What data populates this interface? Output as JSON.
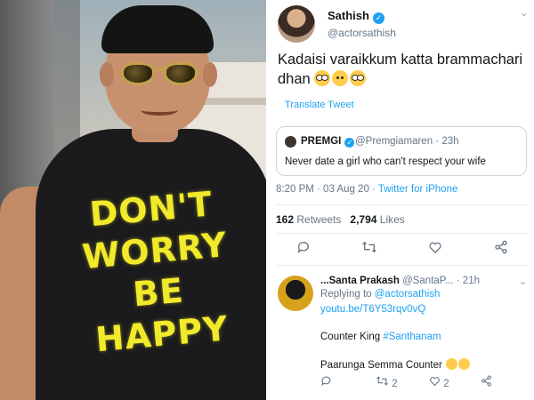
{
  "tweet": {
    "author_name": "Sathish",
    "author_handle": "@actorsathish",
    "text": "Kadaisi varaikkum katta brammachari dhan",
    "translate_label": "Translate Tweet",
    "quoted": {
      "author_name": "PREMGI",
      "author_handle": "@Premgiamaren",
      "time": "23h",
      "text": "Never date a girl who can't respect your wife"
    },
    "timestamp": "8:20 PM · 03 Aug 20",
    "via": "Twitter for iPhone",
    "retweets": "162",
    "retweets_label": "Retweets",
    "likes": "2,794",
    "likes_label": "Likes"
  },
  "photo": {
    "shirt_text": "DON'T WORRY BE HAPPY"
  },
  "reply": {
    "author_name": "...Santa Prakash",
    "author_handle": "@SantaP...",
    "time": "21h",
    "replying_prefix": "Replying to",
    "replying_to": "@actorsathish",
    "link": "youtu.be/T6Y53rqv0vQ",
    "line1_prefix": "Counter King",
    "line1_tag": "#Santhanam",
    "line2": "Paarunga Semma Counter",
    "retweet_count": "2",
    "like_count": "2"
  },
  "colors": {
    "accent": "#1da1f2",
    "muted": "#657786",
    "text": "#14171a",
    "shirt_print": "#f1ea2b"
  },
  "icons": [
    "verified-badge-icon",
    "chevron-down-icon",
    "reply-icon",
    "retweet-icon",
    "like-icon",
    "share-icon"
  ]
}
